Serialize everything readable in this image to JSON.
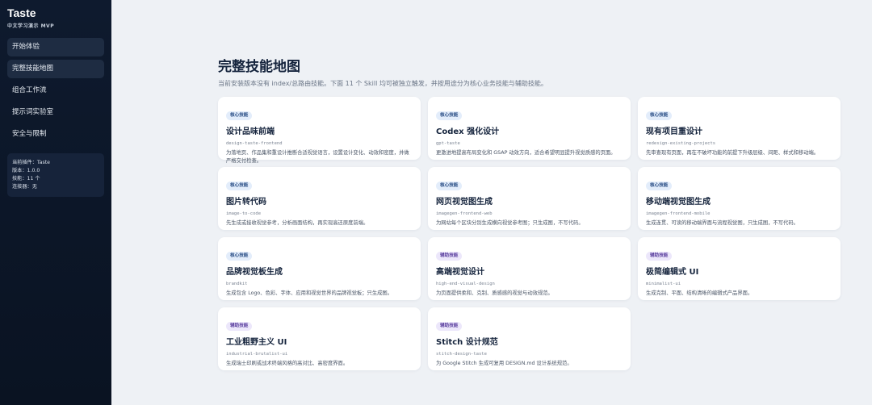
{
  "app": {
    "title": "Taste",
    "subtitle": "中文学习演示 MVP"
  },
  "nav": {
    "items": [
      {
        "label": "开始体验"
      },
      {
        "label": "完整技能地图"
      },
      {
        "label": "组合工作流"
      },
      {
        "label": "提示词实验室"
      },
      {
        "label": "安全与限制"
      }
    ]
  },
  "info": {
    "plugin": "当前插件：Taste",
    "version": "版本：1.0.0",
    "skills": "技能：11 个",
    "connector": "连接器：无"
  },
  "page": {
    "title": "完整技能地图",
    "description": "当前安装版本没有 index/总路由技能。下面 11 个 Skill 均可被独立触发，并按用途分为核心业务技能与辅助技能。"
  },
  "cards": [
    {
      "badge": "核心技能",
      "kind": "core",
      "title": "设计品味前端",
      "code": "design-taste-frontend",
      "desc": "为落地页、作品集和重设计推断合适视觉语言，设置设计变化、动效和密度，并做严格交付检查。"
    },
    {
      "badge": "核心技能",
      "kind": "core",
      "title": "Codex 强化设计",
      "code": "gpt-taste",
      "desc": "更激进地提高布局变化和 GSAP 动效方向，适合希望明显提升视觉质感的页面。"
    },
    {
      "badge": "核心技能",
      "kind": "core",
      "title": "现有项目重设计",
      "code": "redesign-existing-projects",
      "desc": "先审查现有页面，再在不破坏功能的前提下升级层级、间距、样式和移动端。"
    },
    {
      "badge": "核心技能",
      "kind": "core",
      "title": "图片转代码",
      "code": "image-to-code",
      "desc": "先生成或接收视觉参考，分析画面结构，再实现高还原度前端。"
    },
    {
      "badge": "核心技能",
      "kind": "core",
      "title": "网页视觉图生成",
      "code": "imagegen-frontend-web",
      "desc": "为网站每个区块分别生成横向视觉参考图；只生成图，不写代码。"
    },
    {
      "badge": "核心技能",
      "kind": "core",
      "title": "移动端视觉图生成",
      "code": "imagegen-frontend-mobile",
      "desc": "生成连贯、可读的移动端界面与流程视觉图，只生成图，不写代码。"
    },
    {
      "badge": "核心技能",
      "kind": "core",
      "title": "品牌视觉板生成",
      "code": "brandkit",
      "desc": "生成包含 Logo、色彩、字体、应用和视觉世界的品牌视觉板；只生成图。"
    },
    {
      "badge": "辅助技能",
      "kind": "aux",
      "title": "高端视觉设计",
      "code": "high-end-visual-design",
      "desc": "为页面提供柔和、克制、质感感的视觉与动效规范。"
    },
    {
      "badge": "辅助技能",
      "kind": "aux",
      "title": "极简编辑式 UI",
      "code": "minimalist-ui",
      "desc": "生成克制、平面、结构清晰的编辑式产品界面。"
    },
    {
      "badge": "辅助技能",
      "kind": "aux",
      "title": "工业粗野主义 UI",
      "code": "industrial-brutalist-ui",
      "desc": "生成瑞士印刷或战术终端风格的高对比、高密度界面。"
    },
    {
      "badge": "辅助技能",
      "kind": "aux",
      "title": "Stitch 设计规范",
      "code": "stitch-design-taste",
      "desc": "为 Google Stitch 生成可复用 DESIGN.md 设计系统规范。"
    }
  ]
}
